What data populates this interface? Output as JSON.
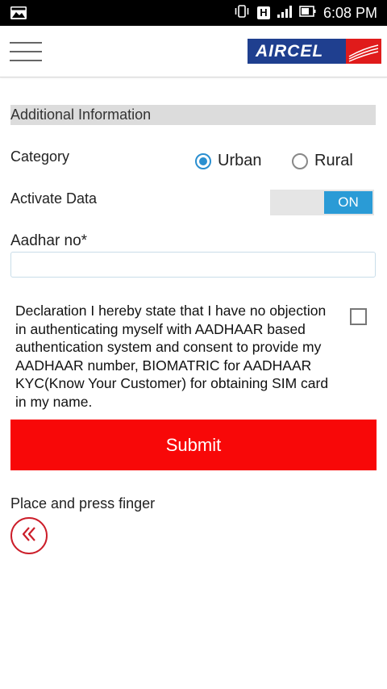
{
  "status_bar": {
    "time": "6:08 PM",
    "network_badge": "H"
  },
  "toolbar": {
    "menu_icon": "hamburger-menu-icon",
    "logo_text": "AIRCEL"
  },
  "section": {
    "title": "Additional Information"
  },
  "category": {
    "label": "Category",
    "options": [
      "Urban",
      "Rural"
    ],
    "selected": "Urban"
  },
  "activate_data": {
    "label": "Activate Data",
    "toggle_text": "ON"
  },
  "aadhar": {
    "label": "Aadhar no*",
    "value": ""
  },
  "declaration": {
    "text": "Declaration I hereby state that I have no objection in authenticating myself with AADHAAR based authentication system and consent to provide my AADHAAR number, BIOMATRIC for AADHAAR KYC(Know Your Customer) for obtaining SIM card in my name.",
    "checked": false
  },
  "submit": {
    "label": "Submit"
  },
  "fingerprint": {
    "label": "Place and press finger"
  },
  "colors": {
    "accent_blue": "#2a9bd6",
    "submit_red": "#f80808",
    "brand_blue": "#1f3f8f",
    "brand_red": "#e01b1b",
    "back_red": "#cc1e2a"
  }
}
